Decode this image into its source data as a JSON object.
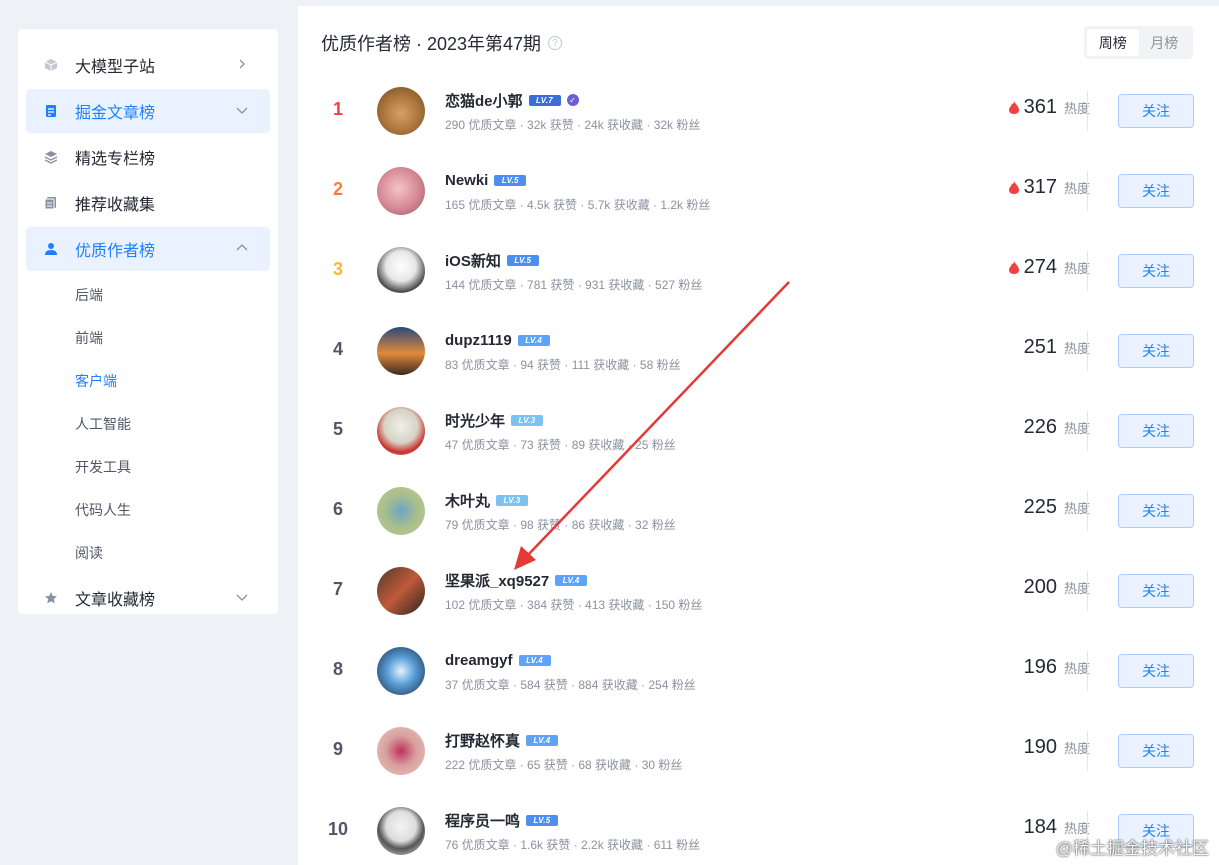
{
  "sidebar": {
    "items": [
      {
        "label": "大模型子站",
        "icon": "cube-icon",
        "chevron": "right"
      },
      {
        "label": "掘金文章榜",
        "icon": "document-icon",
        "chevron": "down"
      },
      {
        "label": "精选专栏榜",
        "icon": "layers-icon"
      },
      {
        "label": "推荐收藏集",
        "icon": "collection-icon"
      },
      {
        "label": "优质作者榜",
        "icon": "user-icon",
        "chevron": "up"
      },
      {
        "label": "文章收藏榜",
        "icon": "star-icon",
        "chevron": "down"
      }
    ],
    "subitems": [
      "后端",
      "前端",
      "客户端",
      "人工智能",
      "开发工具",
      "代码人生",
      "阅读"
    ]
  },
  "main": {
    "title": "优质作者榜 · 2023年第47期",
    "help_icon": "?",
    "tabs": [
      "周榜",
      "月榜"
    ]
  },
  "authors": [
    {
      "rank": "1",
      "name": "恋猫de小郭",
      "level": "LV.7",
      "stats": "290 优质文章 · 32k 获赞 · 24k 获收藏 · 32k 粉丝",
      "hot": "361",
      "unit": "热度",
      "follow": "关注"
    },
    {
      "rank": "2",
      "name": "Newki",
      "level": "LV.5",
      "stats": "165 优质文章 · 4.5k 获赞 · 5.7k 获收藏 · 1.2k 粉丝",
      "hot": "317",
      "unit": "热度",
      "follow": "关注"
    },
    {
      "rank": "3",
      "name": "iOS新知",
      "level": "LV.5",
      "stats": "144 优质文章 · 781 获赞 · 931 获收藏 · 527 粉丝",
      "hot": "274",
      "unit": "热度",
      "follow": "关注"
    },
    {
      "rank": "4",
      "name": "dupz1119",
      "level": "LV.4",
      "stats": "83 优质文章 · 94 获赞 · 111 获收藏 · 58 粉丝",
      "hot": "251",
      "unit": "热度",
      "follow": "关注"
    },
    {
      "rank": "5",
      "name": "时光少年",
      "level": "LV.3",
      "stats": "47 优质文章 · 73 获赞 · 89 获收藏 · 25 粉丝",
      "hot": "226",
      "unit": "热度",
      "follow": "关注"
    },
    {
      "rank": "6",
      "name": "木叶丸",
      "level": "LV.3",
      "stats": "79 优质文章 · 98 获赞 · 86 获收藏 · 32 粉丝",
      "hot": "225",
      "unit": "热度",
      "follow": "关注"
    },
    {
      "rank": "7",
      "name": "坚果派_xq9527",
      "level": "LV.4",
      "stats": "102 优质文章 · 384 获赞 · 413 获收藏 · 150 粉丝",
      "hot": "200",
      "unit": "热度",
      "follow": "关注"
    },
    {
      "rank": "8",
      "name": "dreamgyf",
      "level": "LV.4",
      "stats": "37 优质文章 · 584 获赞 · 884 获收藏 · 254 粉丝",
      "hot": "196",
      "unit": "热度",
      "follow": "关注"
    },
    {
      "rank": "9",
      "name": "打野赵怀真",
      "level": "LV.4",
      "stats": "222 优质文章 · 65 获赞 · 68 获收藏 · 30 粉丝",
      "hot": "190",
      "unit": "热度",
      "follow": "关注"
    },
    {
      "rank": "10",
      "name": "程序员一鸣",
      "level": "LV.5",
      "stats": "76 优质文章 · 1.6k 获赞 · 2.2k 获收藏 · 611 粉丝",
      "hot": "184",
      "unit": "热度",
      "follow": "关注"
    }
  ],
  "watermark": "@稀土掘金技术社区",
  "colors": {
    "accent": "#1e80ff",
    "rank1": "#f04142",
    "rank2": "#ff7d36",
    "rank3": "#ffb72e",
    "flame": "#f04142"
  }
}
